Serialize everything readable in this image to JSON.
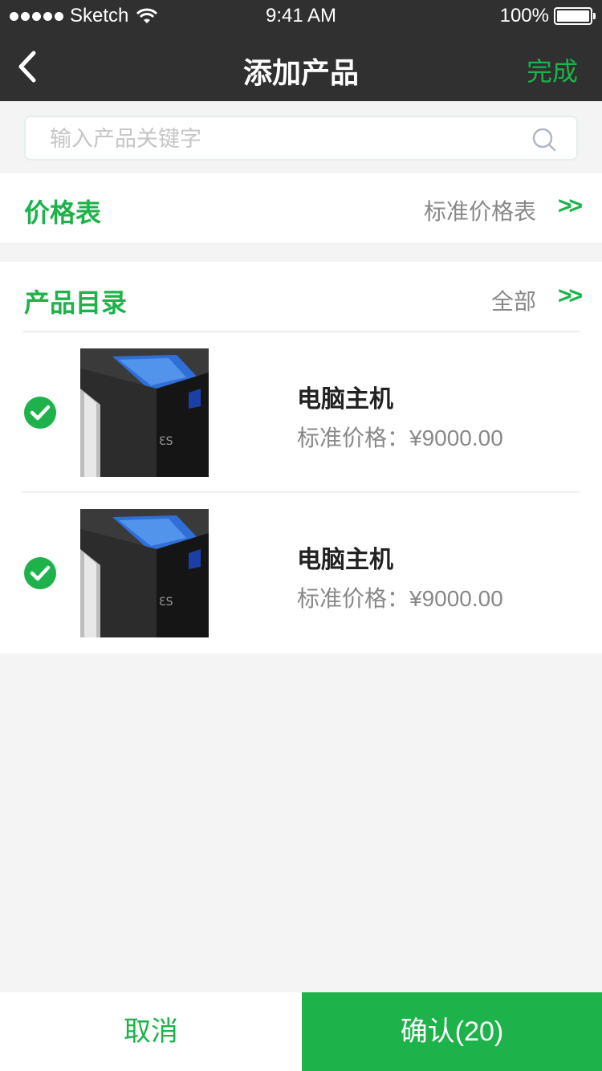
{
  "status_bar": {
    "carrier": "Sketch",
    "time": "9:41 AM",
    "battery": "100%"
  },
  "nav": {
    "title": "添加产品",
    "done_label": "完成"
  },
  "search": {
    "placeholder": "输入产品关键字",
    "value": ""
  },
  "price_list": {
    "label": "价格表",
    "value": "标准价格表",
    "arrow": ">>"
  },
  "catalog": {
    "label": "产品目录",
    "value": "全部",
    "arrow": ">>",
    "items": [
      {
        "name": "电脑主机",
        "price": "标准价格：¥9000.00",
        "selected": true
      },
      {
        "name": "电脑主机",
        "price": "标准价格：¥9000.00",
        "selected": true
      }
    ]
  },
  "bottom": {
    "cancel_label": "取消",
    "confirm_label": "确认(20)"
  },
  "colors": {
    "accent": "#1db34a",
    "nav_bg": "#303030",
    "page_bg": "#f4f4f4"
  }
}
